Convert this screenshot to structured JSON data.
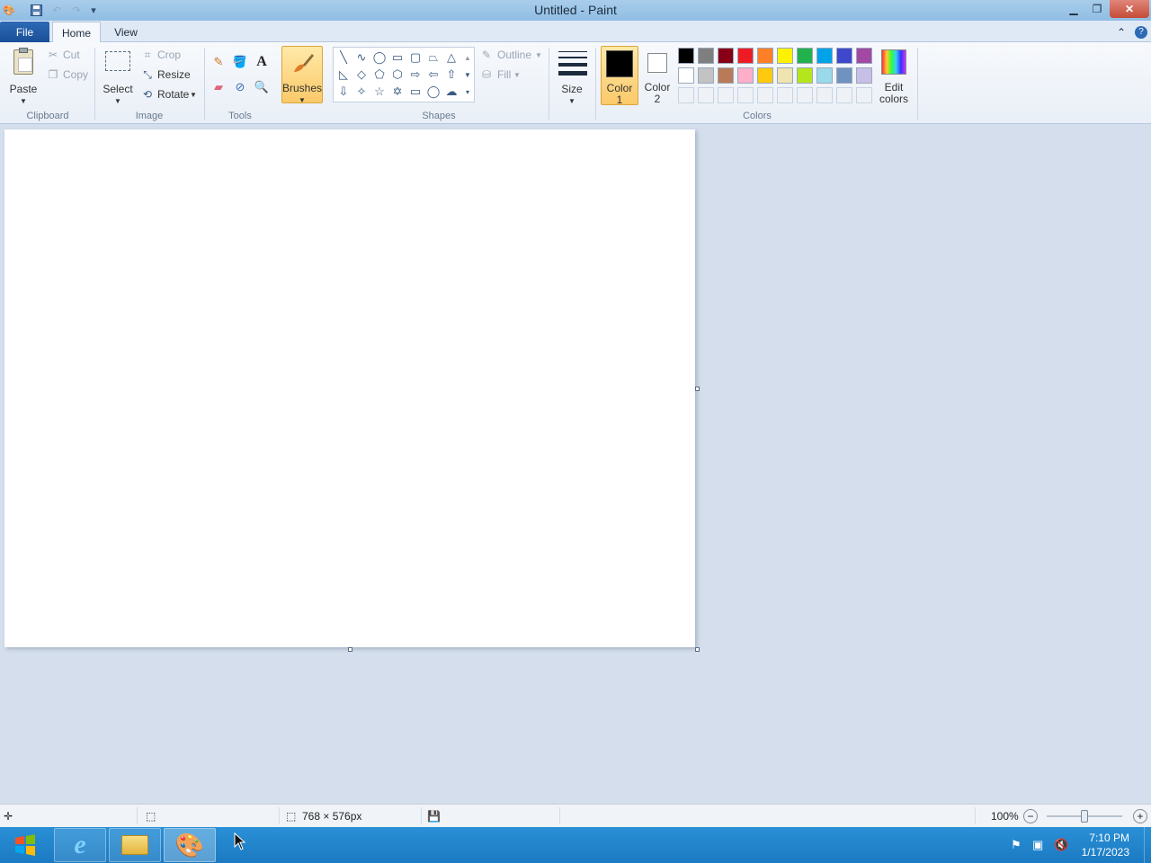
{
  "window": {
    "title": "Untitled - Paint"
  },
  "tabs": [
    {
      "label": "File"
    },
    {
      "label": "Home"
    },
    {
      "label": "View"
    }
  ],
  "clipboard": {
    "group": "Clipboard",
    "paste": "Paste",
    "cut": "Cut",
    "copy": "Copy"
  },
  "image": {
    "group": "Image",
    "select": "Select",
    "crop": "Crop",
    "resize": "Resize",
    "rotate": "Rotate"
  },
  "tools": {
    "group": "Tools"
  },
  "brushes": {
    "label": "Brushes"
  },
  "shapes": {
    "group": "Shapes",
    "outline": "Outline",
    "fill": "Fill"
  },
  "size": {
    "label": "Size"
  },
  "colors": {
    "group": "Colors",
    "color1_a": "Color",
    "color1_b": "1",
    "color2_a": "Color",
    "color2_b": "2",
    "edit_a": "Edit",
    "edit_b": "colors",
    "color1_value": "#000000",
    "color2_value": "#ffffff",
    "palette_row1": [
      "#000000",
      "#7f7f7f",
      "#880015",
      "#ed1c24",
      "#ff7f27",
      "#fff200",
      "#22b14c",
      "#00a2e8",
      "#3f48cc",
      "#a349a4"
    ],
    "palette_row2": [
      "#ffffff",
      "#c3c3c3",
      "#b97a57",
      "#ffaec9",
      "#ffc90e",
      "#efe4b0",
      "#b5e61d",
      "#99d9ea",
      "#7092be",
      "#c8bfe7"
    ]
  },
  "status": {
    "dimensions": "768 × 576px",
    "zoom": "100%"
  },
  "taskbar": {
    "time": "7:10 PM",
    "date": "1/17/2023"
  }
}
